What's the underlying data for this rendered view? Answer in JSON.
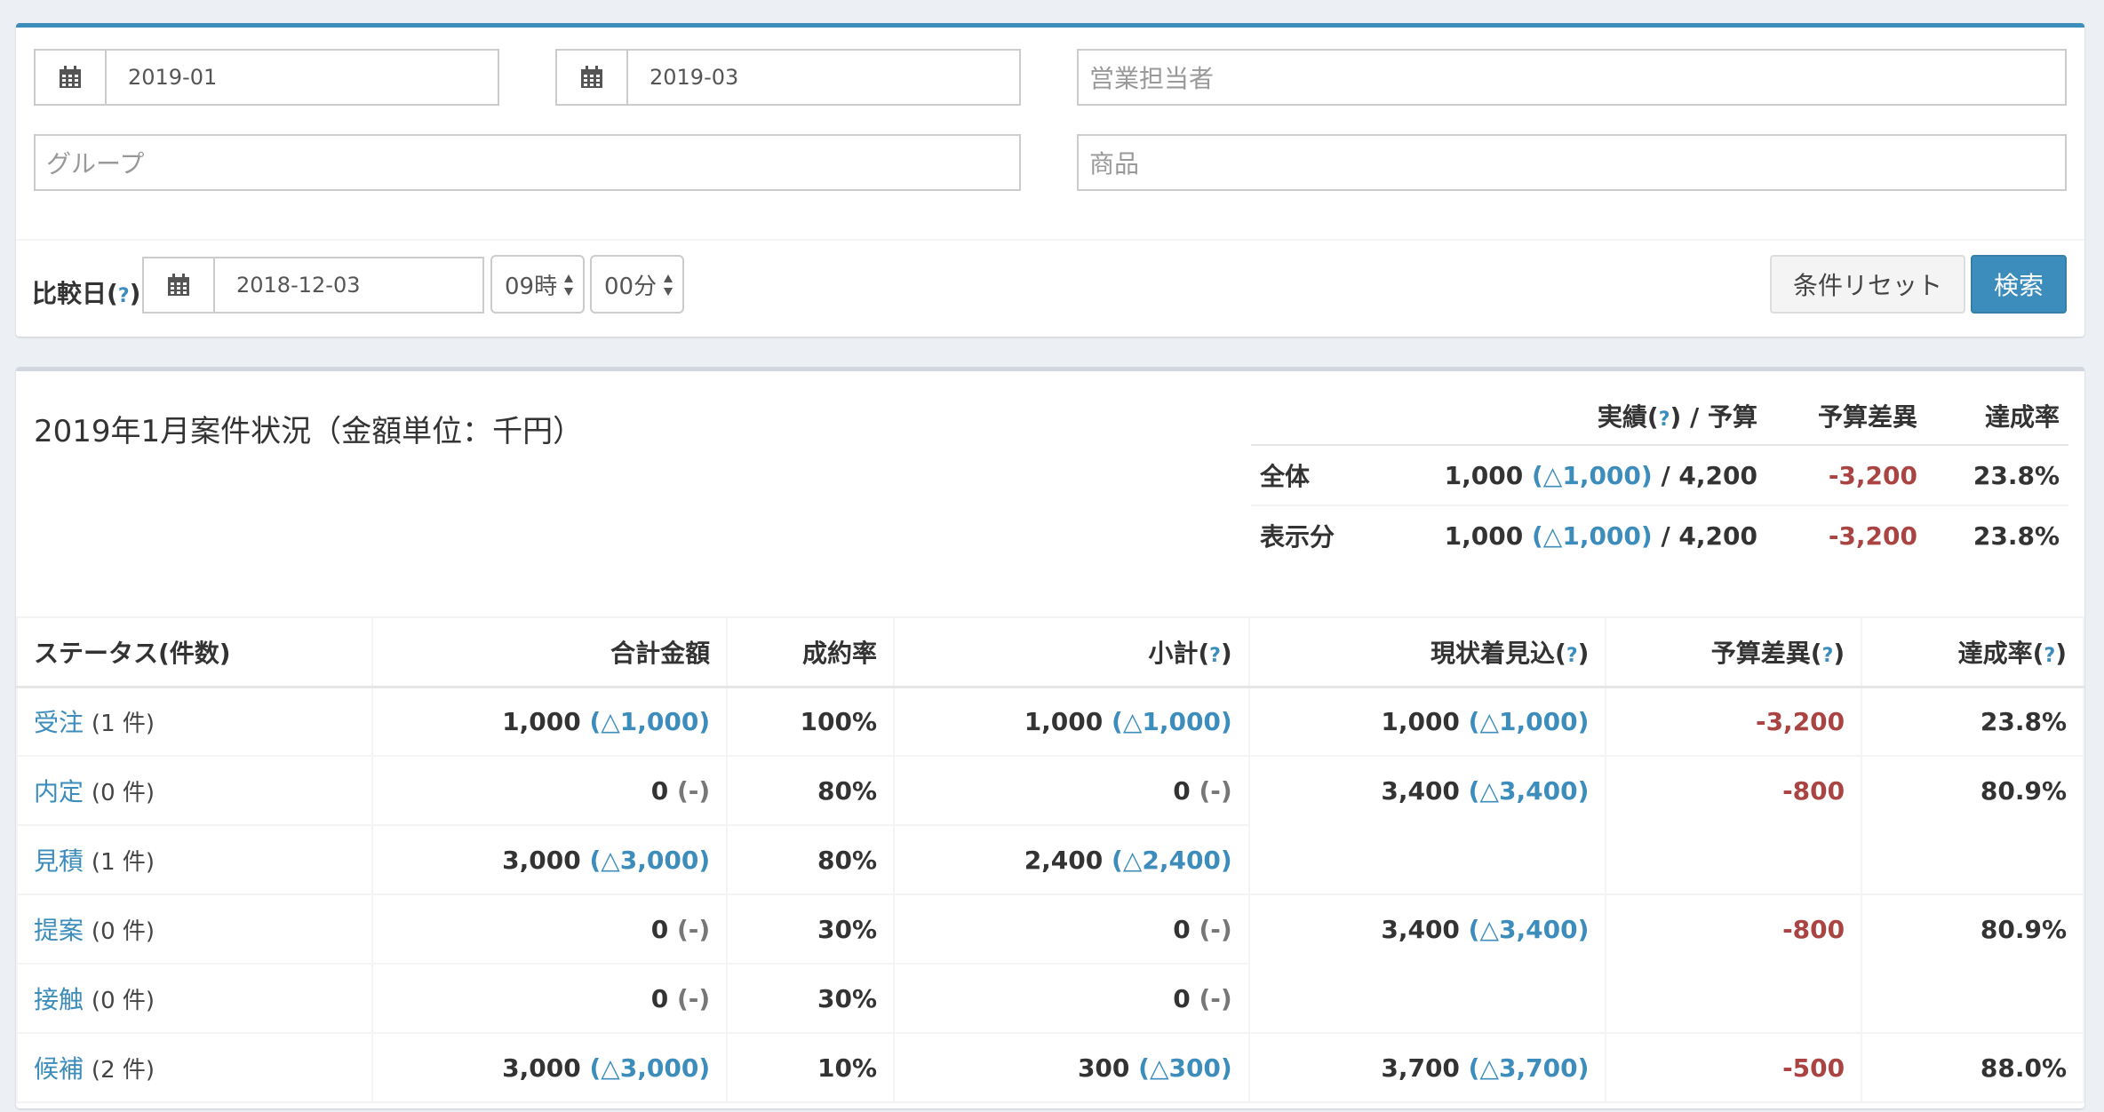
{
  "filters": {
    "from_date": "2019-01",
    "to_date": "2019-03",
    "sales_rep_placeholder": "営業担当者",
    "group_placeholder": "グループ",
    "product_placeholder": "商品",
    "compare_label": "比較日",
    "help_mark": "?",
    "compare_date": "2018-12-03",
    "hour": "09時",
    "minute": "00分",
    "reset_label": "条件リセット",
    "search_label": "検索"
  },
  "summary": {
    "title": "2019年1月案件状況（金額単位：千円）",
    "header": {
      "actual": "実績",
      "slash_budget": "/ 予算",
      "diff": "予算差異",
      "rate": "達成率"
    },
    "rows": [
      {
        "label": "全体",
        "actual": "1,000",
        "delta": "(△1,000)",
        "budget": "/ 4,200",
        "diff": "-3,200",
        "rate": "23.8%"
      },
      {
        "label": "表示分",
        "actual": "1,000",
        "delta": "(△1,000)",
        "budget": "/ 4,200",
        "diff": "-3,200",
        "rate": "23.8%"
      }
    ]
  },
  "table": {
    "headers": {
      "status": "ステータス(件数)",
      "total": "合計金額",
      "rate": "成約率",
      "subtotal": "小計",
      "forecast": "現状着見込",
      "diff": "予算差異",
      "achieve": "達成率"
    },
    "rows": [
      {
        "status": "受注",
        "count": "(1 件)",
        "total": "1,000",
        "total_delta": "(△1,000)",
        "rate": "100%",
        "sub": "1,000",
        "sub_delta": "(△1,000)"
      },
      {
        "status": "内定",
        "count": "(0 件)",
        "total": "0",
        "total_delta": "(-)",
        "rate": "80%",
        "sub": "0",
        "sub_delta": "(-)"
      },
      {
        "status": "見積",
        "count": "(1 件)",
        "total": "3,000",
        "total_delta": "(△3,000)",
        "rate": "80%",
        "sub": "2,400",
        "sub_delta": "(△2,400)"
      },
      {
        "status": "提案",
        "count": "(0 件)",
        "total": "0",
        "total_delta": "(-)",
        "rate": "30%",
        "sub": "0",
        "sub_delta": "(-)"
      },
      {
        "status": "接触",
        "count": "(0 件)",
        "total": "0",
        "total_delta": "(-)",
        "rate": "30%",
        "sub": "0",
        "sub_delta": "(-)"
      },
      {
        "status": "候補",
        "count": "(2 件)",
        "total": "3,000",
        "total_delta": "(△3,000)",
        "rate": "10%",
        "sub": "300",
        "sub_delta": "(△300)"
      }
    ],
    "groups": [
      {
        "forecast": "1,000",
        "forecast_delta": "(△1,000)",
        "diff": "-3,200",
        "achieve": "23.8%"
      },
      {
        "forecast": "3,400",
        "forecast_delta": "(△3,400)",
        "diff": "-800",
        "achieve": "80.9%"
      },
      {
        "forecast": "3,400",
        "forecast_delta": "(△3,400)",
        "diff": "-800",
        "achieve": "80.9%"
      },
      {
        "forecast": "3,700",
        "forecast_delta": "(△3,700)",
        "diff": "-500",
        "achieve": "88.0%"
      }
    ]
  }
}
